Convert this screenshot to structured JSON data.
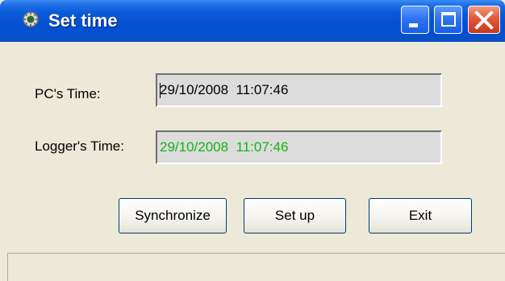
{
  "window": {
    "title": "Set time",
    "app_icon": "gear-globe-icon",
    "controls": {
      "minimize": "minimize-icon",
      "maximize": "maximize-icon",
      "close": "close-icon"
    }
  },
  "fields": {
    "pc_time": {
      "label": "PC's Time:",
      "value": "29/10/2008  11:07:46",
      "color": "#000000"
    },
    "logger_time": {
      "label": "Logger's Time:",
      "value": "29/10/2008  11:07:46",
      "color": "#11b511"
    }
  },
  "buttons": {
    "synchronize": "Synchronize",
    "set_up": "Set up",
    "exit": "Exit"
  },
  "status": {
    "text": ""
  },
  "colors": {
    "titlebar": "#0550d2",
    "window_bg": "#ece9d8",
    "close_button": "#e2573a"
  }
}
